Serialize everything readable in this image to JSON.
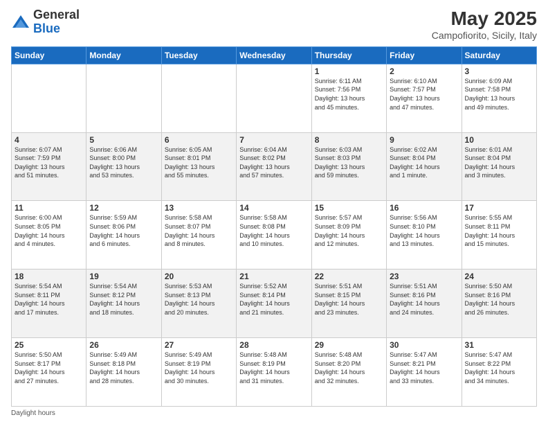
{
  "header": {
    "logo_general": "General",
    "logo_blue": "Blue",
    "month_title": "May 2025",
    "location": "Campofiorito, Sicily, Italy"
  },
  "days_of_week": [
    "Sunday",
    "Monday",
    "Tuesday",
    "Wednesday",
    "Thursday",
    "Friday",
    "Saturday"
  ],
  "footer_label": "Daylight hours",
  "weeks": [
    [
      {
        "day": "",
        "info": ""
      },
      {
        "day": "",
        "info": ""
      },
      {
        "day": "",
        "info": ""
      },
      {
        "day": "",
        "info": ""
      },
      {
        "day": "1",
        "info": "Sunrise: 6:11 AM\nSunset: 7:56 PM\nDaylight: 13 hours\nand 45 minutes."
      },
      {
        "day": "2",
        "info": "Sunrise: 6:10 AM\nSunset: 7:57 PM\nDaylight: 13 hours\nand 47 minutes."
      },
      {
        "day": "3",
        "info": "Sunrise: 6:09 AM\nSunset: 7:58 PM\nDaylight: 13 hours\nand 49 minutes."
      }
    ],
    [
      {
        "day": "4",
        "info": "Sunrise: 6:07 AM\nSunset: 7:59 PM\nDaylight: 13 hours\nand 51 minutes."
      },
      {
        "day": "5",
        "info": "Sunrise: 6:06 AM\nSunset: 8:00 PM\nDaylight: 13 hours\nand 53 minutes."
      },
      {
        "day": "6",
        "info": "Sunrise: 6:05 AM\nSunset: 8:01 PM\nDaylight: 13 hours\nand 55 minutes."
      },
      {
        "day": "7",
        "info": "Sunrise: 6:04 AM\nSunset: 8:02 PM\nDaylight: 13 hours\nand 57 minutes."
      },
      {
        "day": "8",
        "info": "Sunrise: 6:03 AM\nSunset: 8:03 PM\nDaylight: 13 hours\nand 59 minutes."
      },
      {
        "day": "9",
        "info": "Sunrise: 6:02 AM\nSunset: 8:04 PM\nDaylight: 14 hours\nand 1 minute."
      },
      {
        "day": "10",
        "info": "Sunrise: 6:01 AM\nSunset: 8:04 PM\nDaylight: 14 hours\nand 3 minutes."
      }
    ],
    [
      {
        "day": "11",
        "info": "Sunrise: 6:00 AM\nSunset: 8:05 PM\nDaylight: 14 hours\nand 4 minutes."
      },
      {
        "day": "12",
        "info": "Sunrise: 5:59 AM\nSunset: 8:06 PM\nDaylight: 14 hours\nand 6 minutes."
      },
      {
        "day": "13",
        "info": "Sunrise: 5:58 AM\nSunset: 8:07 PM\nDaylight: 14 hours\nand 8 minutes."
      },
      {
        "day": "14",
        "info": "Sunrise: 5:58 AM\nSunset: 8:08 PM\nDaylight: 14 hours\nand 10 minutes."
      },
      {
        "day": "15",
        "info": "Sunrise: 5:57 AM\nSunset: 8:09 PM\nDaylight: 14 hours\nand 12 minutes."
      },
      {
        "day": "16",
        "info": "Sunrise: 5:56 AM\nSunset: 8:10 PM\nDaylight: 14 hours\nand 13 minutes."
      },
      {
        "day": "17",
        "info": "Sunrise: 5:55 AM\nSunset: 8:11 PM\nDaylight: 14 hours\nand 15 minutes."
      }
    ],
    [
      {
        "day": "18",
        "info": "Sunrise: 5:54 AM\nSunset: 8:11 PM\nDaylight: 14 hours\nand 17 minutes."
      },
      {
        "day": "19",
        "info": "Sunrise: 5:54 AM\nSunset: 8:12 PM\nDaylight: 14 hours\nand 18 minutes."
      },
      {
        "day": "20",
        "info": "Sunrise: 5:53 AM\nSunset: 8:13 PM\nDaylight: 14 hours\nand 20 minutes."
      },
      {
        "day": "21",
        "info": "Sunrise: 5:52 AM\nSunset: 8:14 PM\nDaylight: 14 hours\nand 21 minutes."
      },
      {
        "day": "22",
        "info": "Sunrise: 5:51 AM\nSunset: 8:15 PM\nDaylight: 14 hours\nand 23 minutes."
      },
      {
        "day": "23",
        "info": "Sunrise: 5:51 AM\nSunset: 8:16 PM\nDaylight: 14 hours\nand 24 minutes."
      },
      {
        "day": "24",
        "info": "Sunrise: 5:50 AM\nSunset: 8:16 PM\nDaylight: 14 hours\nand 26 minutes."
      }
    ],
    [
      {
        "day": "25",
        "info": "Sunrise: 5:50 AM\nSunset: 8:17 PM\nDaylight: 14 hours\nand 27 minutes."
      },
      {
        "day": "26",
        "info": "Sunrise: 5:49 AM\nSunset: 8:18 PM\nDaylight: 14 hours\nand 28 minutes."
      },
      {
        "day": "27",
        "info": "Sunrise: 5:49 AM\nSunset: 8:19 PM\nDaylight: 14 hours\nand 30 minutes."
      },
      {
        "day": "28",
        "info": "Sunrise: 5:48 AM\nSunset: 8:19 PM\nDaylight: 14 hours\nand 31 minutes."
      },
      {
        "day": "29",
        "info": "Sunrise: 5:48 AM\nSunset: 8:20 PM\nDaylight: 14 hours\nand 32 minutes."
      },
      {
        "day": "30",
        "info": "Sunrise: 5:47 AM\nSunset: 8:21 PM\nDaylight: 14 hours\nand 33 minutes."
      },
      {
        "day": "31",
        "info": "Sunrise: 5:47 AM\nSunset: 8:22 PM\nDaylight: 14 hours\nand 34 minutes."
      }
    ]
  ]
}
